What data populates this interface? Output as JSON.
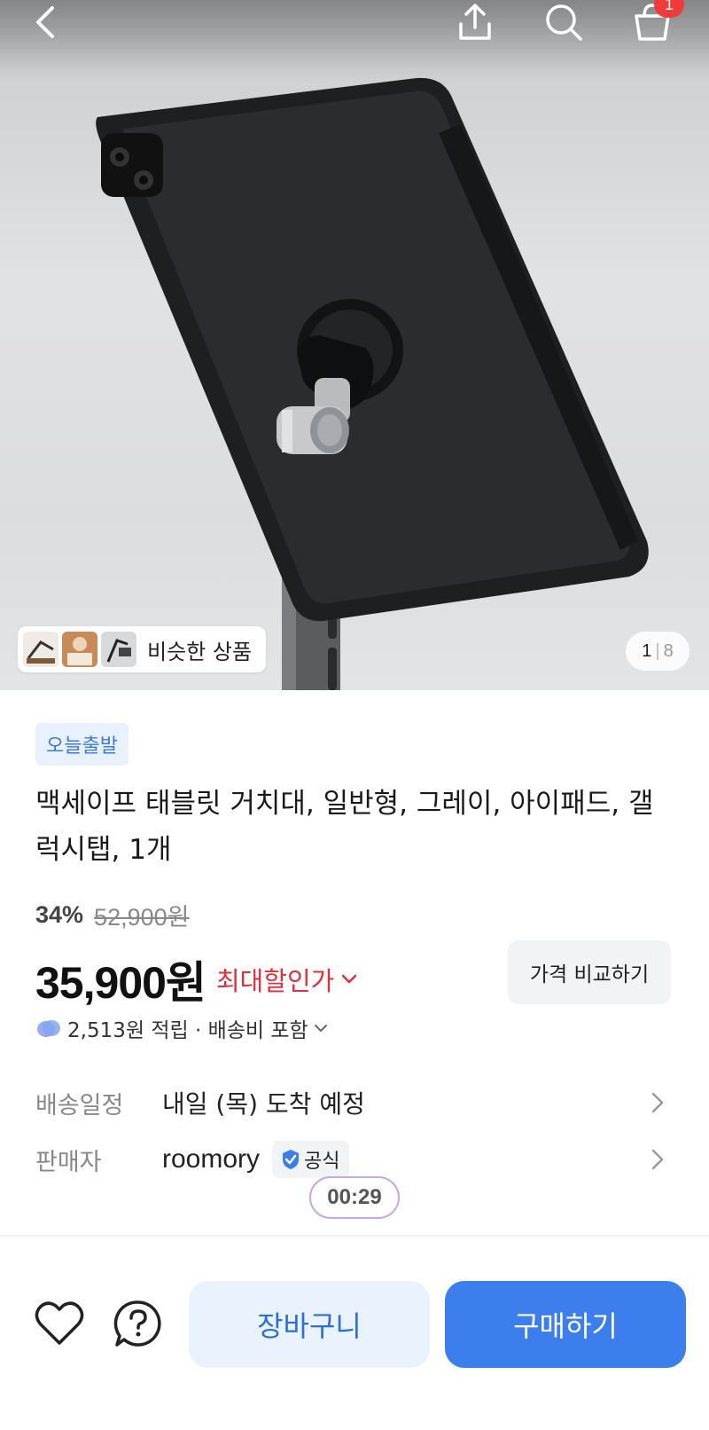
{
  "header": {
    "back_icon": "chevron-left-icon",
    "share_icon": "share-icon",
    "search_icon": "search-icon",
    "cart_icon": "cart-icon",
    "cart_badge": "1"
  },
  "gallery": {
    "similar_label": "비슷한 상품",
    "page_current": "1",
    "page_separator": "|",
    "page_total": "8"
  },
  "product": {
    "delivery_badge": "오늘출발",
    "title": "맥세이프 태블릿 거치대, 일반형, 그레이, 아이패드, 갤럭시탭, 1개",
    "discount_rate": "34%",
    "original_price": "52,900원",
    "price": "35,900원",
    "max_discount_label": "최대할인가",
    "compare_button": "가격 비교하기",
    "points_text": "2,513원 적립 · 배송비 포함"
  },
  "info": {
    "delivery_key": "배송일정",
    "delivery_value": "내일 (목) 도착 예정",
    "seller_key": "판매자",
    "seller_value": "roomory",
    "official_badge": "공식"
  },
  "timer": "00:29",
  "bottom_bar": {
    "cart_button": "장바구니",
    "buy_button": "구매하기"
  },
  "colors": {
    "primary": "#3b7eec",
    "danger": "#e0303c",
    "badge_bg": "#e8f1fd"
  }
}
